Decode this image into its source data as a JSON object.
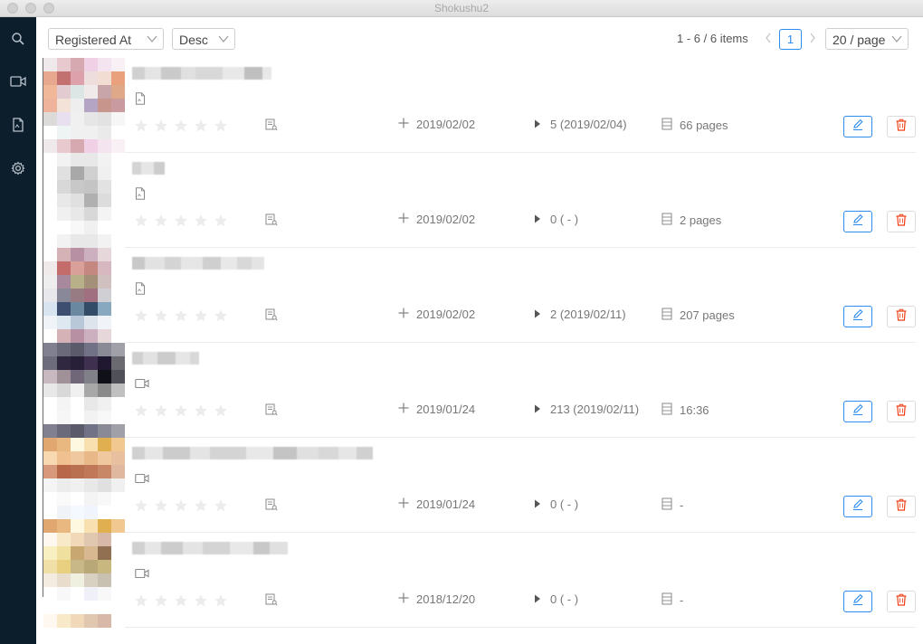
{
  "window": {
    "title": "Shokushu2"
  },
  "sidebar": {
    "items": [
      {
        "icon": "search-icon"
      },
      {
        "icon": "video-icon"
      },
      {
        "icon": "document-icon"
      },
      {
        "icon": "gear-icon"
      }
    ]
  },
  "toolbar": {
    "sort_field": "Registered At",
    "sort_order": "Desc",
    "items_count": "1 - 6 / 6 items",
    "current_page": "1",
    "page_size": "20 / page"
  },
  "colors": {
    "accent": "#2d8cf0",
    "danger": "#ed3f14",
    "sidebar": "#0c1d2c"
  },
  "rows": [
    {
      "type": "document",
      "added": "2019/02/02",
      "plays": "5 (2019/02/04)",
      "length": "66 pages"
    },
    {
      "type": "document",
      "added": "2019/02/02",
      "plays": "0 ( - )",
      "length": "2 pages"
    },
    {
      "type": "document",
      "added": "2019/02/02",
      "plays": "2 (2019/02/11)",
      "length": "207 pages"
    },
    {
      "type": "video",
      "added": "2019/01/24",
      "plays": "213 (2019/02/11)",
      "length": "16:36"
    },
    {
      "type": "video",
      "added": "2019/01/24",
      "plays": "0 ( - )",
      "length": "-"
    },
    {
      "type": "video",
      "added": "2018/12/20",
      "plays": "0 ( - )",
      "length": "-"
    }
  ]
}
